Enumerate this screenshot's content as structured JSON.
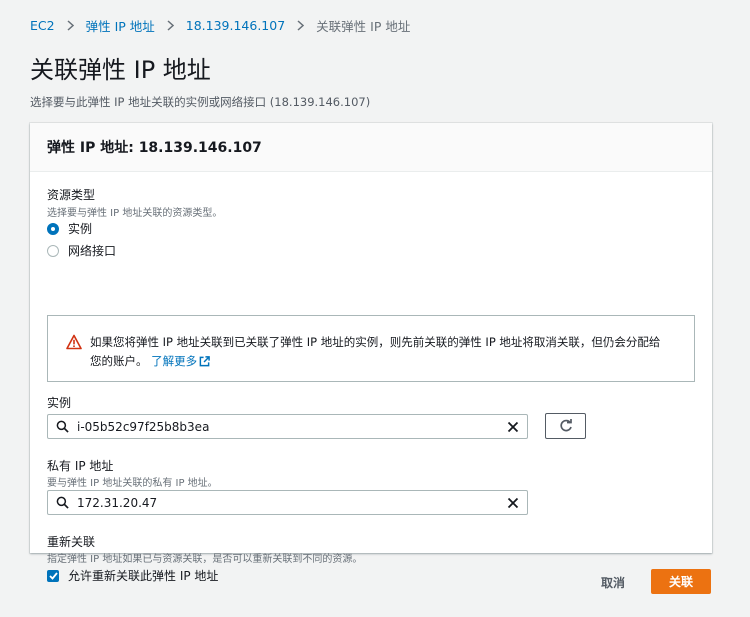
{
  "breadcrumb": {
    "items": [
      "EC2",
      "弹性 IP 地址",
      "18.139.146.107"
    ],
    "current": "关联弹性 IP 地址"
  },
  "page": {
    "title": "关联弹性 IP 地址",
    "description": "选择要与此弹性 IP 地址关联的实例或网络接口 (18.139.146.107)"
  },
  "panel": {
    "title": "弹性 IP 地址: 18.139.146.107"
  },
  "resource_type": {
    "label": "资源类型",
    "description": "选择要与弹性 IP 地址关联的资源类型。",
    "options": [
      "实例",
      "网络接口"
    ],
    "selected": "实例"
  },
  "alert": {
    "line1": "如果您将弹性 IP 地址关联到已关联了弹性 IP 地址的实例，则先前关联的弹性 IP 地址将取消关联，但仍会分配给",
    "line2": "您的账户。",
    "link": "了解更多"
  },
  "instance": {
    "label": "实例",
    "value": "i-05b52c97f25b8b3ea"
  },
  "private_ip": {
    "label": "私有 IP 地址",
    "description": "要与弹性 IP 地址关联的私有 IP 地址。",
    "value": "172.31.20.47"
  },
  "reassociation": {
    "label": "重新关联",
    "description": "指定弹性 IP 地址如果已与资源关联，是否可以重新关联到不同的资源。",
    "checkbox_label": "允许重新关联此弹性 IP 地址",
    "checked": true
  },
  "actions": {
    "cancel": "取消",
    "associate": "关联"
  },
  "colors": {
    "link": "#0073bb",
    "primary": "#ec7211",
    "warning": "#d13212"
  }
}
